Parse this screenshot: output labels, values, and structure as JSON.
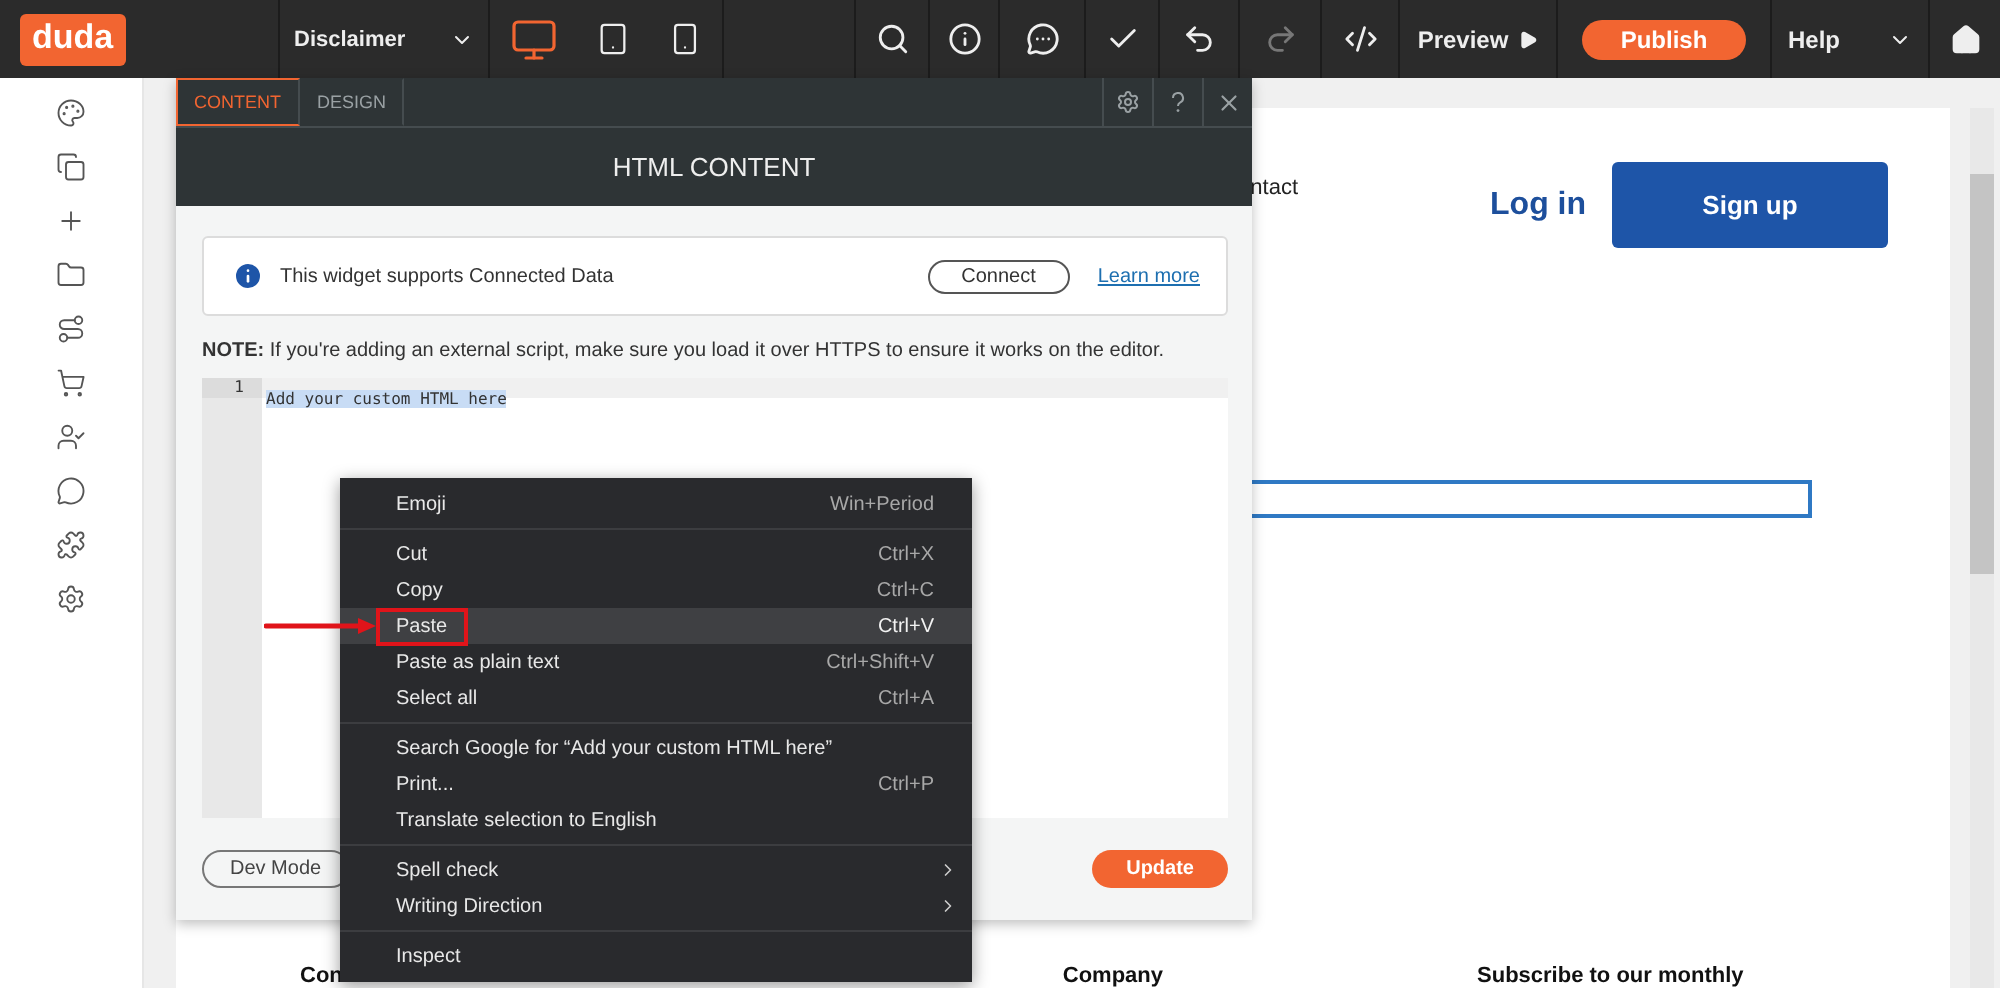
{
  "top_bar": {
    "logo": "duda",
    "page_selector": "Disclaimer",
    "devices": [
      {
        "kind": "desktop",
        "selected": true
      },
      {
        "kind": "tablet",
        "selected": false
      },
      {
        "kind": "phone",
        "selected": false
      }
    ],
    "tools": [
      {
        "kind": "search",
        "disabled": false
      },
      {
        "kind": "info",
        "disabled": false
      },
      {
        "kind": "comment",
        "disabled": false
      },
      {
        "kind": "check",
        "disabled": false
      },
      {
        "kind": "undo",
        "disabled": false
      },
      {
        "kind": "redo",
        "disabled": true
      },
      {
        "kind": "code",
        "disabled": false
      }
    ],
    "preview": "Preview",
    "publish": "Publish",
    "help": "Help"
  },
  "sidebar": {
    "items": [
      {
        "kind": "palette"
      },
      {
        "kind": "pages"
      },
      {
        "kind": "add"
      },
      {
        "kind": "folder"
      },
      {
        "kind": "route"
      },
      {
        "kind": "cart"
      },
      {
        "kind": "user"
      },
      {
        "kind": "chat"
      },
      {
        "kind": "plugin"
      },
      {
        "kind": "settings"
      }
    ]
  },
  "site_preview": {
    "nav_link": "ntact",
    "login": "Log in",
    "signup": "Sign up",
    "footer": [
      "Con",
      "Company",
      "Subscribe to our monthly"
    ]
  },
  "panel": {
    "tabs": [
      {
        "label": "CONTENT",
        "selected": true
      },
      {
        "label": "DESIGN",
        "selected": false
      }
    ],
    "title": "HTML CONTENT",
    "info": {
      "text": "This widget supports Connected Data",
      "connect": "Connect",
      "learn_more": "Learn more"
    },
    "note": "**NOTE:** If you're adding an external script, make sure you load it over HTTPS to ensure it works on the editor.",
    "editor": {
      "line_number": "1",
      "code": "Add your custom HTML here"
    },
    "dev_mode": "Dev Mode",
    "update": "Update"
  },
  "context_menu": {
    "groups": [
      [
        {
          "label": "Emoji",
          "shortcut": "Win+Period",
          "selected": false,
          "submenu": false,
          "annotated": false
        }
      ],
      [
        {
          "label": "Cut",
          "shortcut": "Ctrl+X",
          "selected": false,
          "submenu": false,
          "annotated": false
        },
        {
          "label": "Copy",
          "shortcut": "Ctrl+C",
          "selected": false,
          "submenu": false,
          "annotated": false
        },
        {
          "label": "Paste",
          "shortcut": "Ctrl+V",
          "selected": true,
          "submenu": false,
          "annotated": true
        },
        {
          "label": "Paste as plain text",
          "shortcut": "Ctrl+Shift+V",
          "selected": false,
          "submenu": false,
          "annotated": false
        },
        {
          "label": "Select all",
          "shortcut": "Ctrl+A",
          "selected": false,
          "submenu": false,
          "annotated": false
        }
      ],
      [
        {
          "label": "Search Google for “Add your custom HTML here”",
          "selected": false,
          "submenu": false,
          "annotated": false
        },
        {
          "label": "Print...",
          "shortcut": "Ctrl+P",
          "selected": false,
          "submenu": false,
          "annotated": false
        },
        {
          "label": "Translate selection to English",
          "selected": false,
          "submenu": false,
          "annotated": false
        }
      ],
      [
        {
          "label": "Spell check",
          "selected": false,
          "submenu": true,
          "annotated": false
        },
        {
          "label": "Writing Direction",
          "selected": false,
          "submenu": true,
          "annotated": false
        }
      ],
      [
        {
          "label": "Inspect",
          "selected": false,
          "submenu": false,
          "annotated": false
        }
      ]
    ]
  }
}
